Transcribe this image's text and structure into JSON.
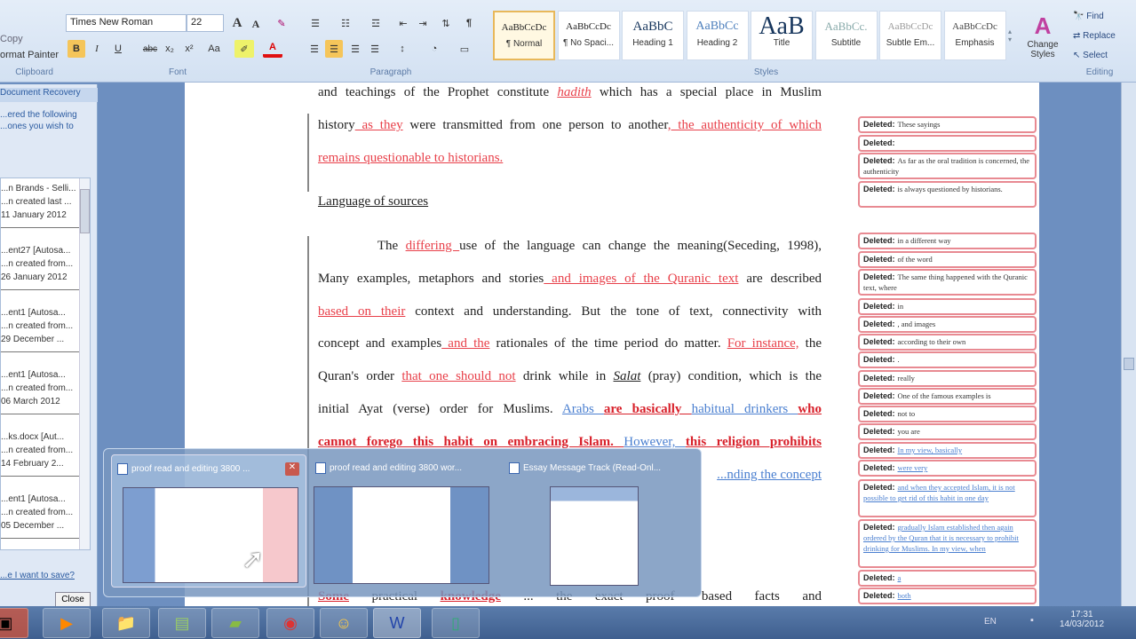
{
  "ribbon": {
    "clipboard": {
      "copy": "Copy",
      "format_painter": "Format Painter",
      "label": "Clipboard"
    },
    "font": {
      "name": "Times New Roman",
      "size": "22",
      "label": "Font",
      "bold": "B",
      "italic": "I",
      "underline": "U",
      "strike": "abc",
      "sub": "x₂",
      "sup": "x²",
      "case": "Aa",
      "grow": "A",
      "shrink": "A"
    },
    "paragraph": {
      "label": "Paragraph",
      "pilcrow": "¶"
    },
    "styles": {
      "label": "Styles",
      "items": [
        {
          "preview": "AaBbCcDc",
          "name": "¶ Normal"
        },
        {
          "preview": "AaBbCcDc",
          "name": "¶ No Spaci..."
        },
        {
          "preview": "AaBbC",
          "name": "Heading 1"
        },
        {
          "preview": "AaBbCc",
          "name": "Heading 2"
        },
        {
          "preview": "AaB",
          "name": "Title"
        },
        {
          "preview": "AaBbCc.",
          "name": "Subtitle"
        },
        {
          "preview": "AaBbCcDc",
          "name": "Subtle Em..."
        },
        {
          "preview": "AaBbCcDc",
          "name": "Emphasis"
        }
      ],
      "change_styles": "Change Styles"
    },
    "editing": {
      "label": "Editing",
      "find": "Find",
      "replace": "Replace",
      "select": "Select"
    }
  },
  "recovery_pane": {
    "title": "Document Recovery",
    "intro": "...ered the following\n...ones you wish to",
    "items": [
      [
        "...n Brands - Selli...",
        "...n created last ...",
        "11 January 2012"
      ],
      [
        "...ent27 [Autosa...",
        "...n created from...",
        "26 January 2012"
      ],
      [
        "...ent1 [Autosa...",
        "...n created from...",
        "29 December ..."
      ],
      [
        "...ent1 [Autosa...",
        "...n created from...",
        "06 March 2012"
      ],
      [
        "...ks.docx [Aut...",
        "...n created from...",
        "14 February 2..."
      ],
      [
        "...ent1 [Autosa...",
        "...n created from...",
        "05 December ..."
      ]
    ],
    "link": "...e I want to save?",
    "close": "Close"
  },
  "document": {
    "lines": [
      [
        {
          "t": "and teachings of the Prophet constitute "
        },
        {
          "t": "hadith",
          "s": "ins it"
        },
        {
          "t": " which has a special place in Muslim"
        }
      ],
      [
        {
          "t": "history"
        },
        {
          "t": " as they",
          "s": "ins"
        },
        {
          "t": " were transmitted from one person to another"
        },
        {
          "t": ", the authenticity of which",
          "s": "ins"
        }
      ],
      [
        {
          "t": "remains questionable to historians.",
          "s": "ins"
        }
      ],
      [
        {
          "t": "Language of sources",
          "s": "u"
        }
      ],
      [
        {
          "t": "        The "
        },
        {
          "t": "differing ",
          "s": "ins"
        },
        {
          "t": "use of the language can change the meaning(Seceding, 1998),"
        }
      ],
      [
        {
          "t": "Many examples, metaphors and stories"
        },
        {
          "t": " and images of the Quranic text",
          "s": "ins"
        },
        {
          "t": " are described"
        }
      ],
      [
        {
          "t": "based on their",
          "s": "ins"
        },
        {
          "t": " context and understanding. But the tone of text, connectivity with"
        }
      ],
      [
        {
          "t": "concept and examples"
        },
        {
          "t": " and the",
          "s": "ins"
        },
        {
          "t": " rationales of the time period do matter. "
        },
        {
          "t": "For instance,",
          "s": "ins"
        },
        {
          "t": " the"
        }
      ],
      [
        {
          "t": "Quran's order "
        },
        {
          "t": "that one should not",
          "s": "ins"
        },
        {
          "t": " drink while in "
        },
        {
          "t": "Salat",
          "s": "it u"
        },
        {
          "t": " (pray) condition, which is the"
        }
      ],
      [
        {
          "t": "initial Ayat (verse) order for Muslims. "
        },
        {
          "t": "Arabs ",
          "s": "blue"
        },
        {
          "t": "are basically ",
          "s": "insb"
        },
        {
          "t": "habitual drinkers ",
          "s": "blue"
        },
        {
          "t": "who",
          "s": "insb"
        }
      ],
      [
        {
          "t": "cannot forego this habit on embracing Islam. ",
          "s": "insb"
        },
        {
          "t": "However, ",
          "s": "blue"
        },
        {
          "t": "this religion prohibits",
          "s": "insb"
        }
      ],
      [
        {
          "t": "...nding the concept",
          "s": "blue"
        }
      ],
      [
        {
          "t": "Some",
          "s": "insb"
        },
        {
          "t": " practical ",
          "s": ""
        },
        {
          "t": "knowledge",
          "s": "insb"
        },
        {
          "t": " ... the exact proof- based facts and"
        }
      ]
    ],
    "comments": [
      {
        "label": "Deleted:",
        "text": "These sayings"
      },
      {
        "label": "Deleted:",
        "text": ""
      },
      {
        "label": "Deleted:",
        "text": "As far as the oral tradition is concerned, the authenticity"
      },
      {
        "label": "Deleted:",
        "text": "is always questioned by historians."
      },
      {
        "label": "Deleted:",
        "text": "in a different way"
      },
      {
        "label": "Deleted:",
        "text": "of the word"
      },
      {
        "label": "Deleted:",
        "text": "The same thing happened with the Quranic text, where"
      },
      {
        "label": "Deleted:",
        "text": "in"
      },
      {
        "label": "Deleted:",
        "text": ", and images"
      },
      {
        "label": "Deleted:",
        "text": "according to their own"
      },
      {
        "label": "Deleted:",
        "text": "."
      },
      {
        "label": "Deleted:",
        "text": "really"
      },
      {
        "label": "Deleted:",
        "text": "One of the famous examples is"
      },
      {
        "label": "Deleted:",
        "text": "not to"
      },
      {
        "label": "Deleted:",
        "text": "you are"
      },
      {
        "label": "Deleted:",
        "text": "In my view, basically",
        "blue": true
      },
      {
        "label": "Deleted:",
        "text": "were very",
        "blue": true
      },
      {
        "label": "Deleted:",
        "text": "and when they accepted Islam, it is not possible to get rid of this habit in one day",
        "blue": true
      },
      {
        "label": "Deleted:",
        "text": "gradually Islam established then again ordered by the Quran that it is necessary to prohibit drinking for Muslims. In my view, when",
        "blue": true
      },
      {
        "label": "Deleted:",
        "text": "a",
        "blue": true
      },
      {
        "label": "Deleted:",
        "text": "both",
        "blue": true
      }
    ]
  },
  "taskbar_popup": {
    "windows": [
      {
        "title": "proof read and editing 3800 ..."
      },
      {
        "title": "proof read and editing 3800 wor..."
      },
      {
        "title": "Essay Message Track (Read-Onl..."
      }
    ]
  },
  "taskbar": {
    "language": "EN",
    "time": "17:31",
    "date": "14/03/2012"
  }
}
